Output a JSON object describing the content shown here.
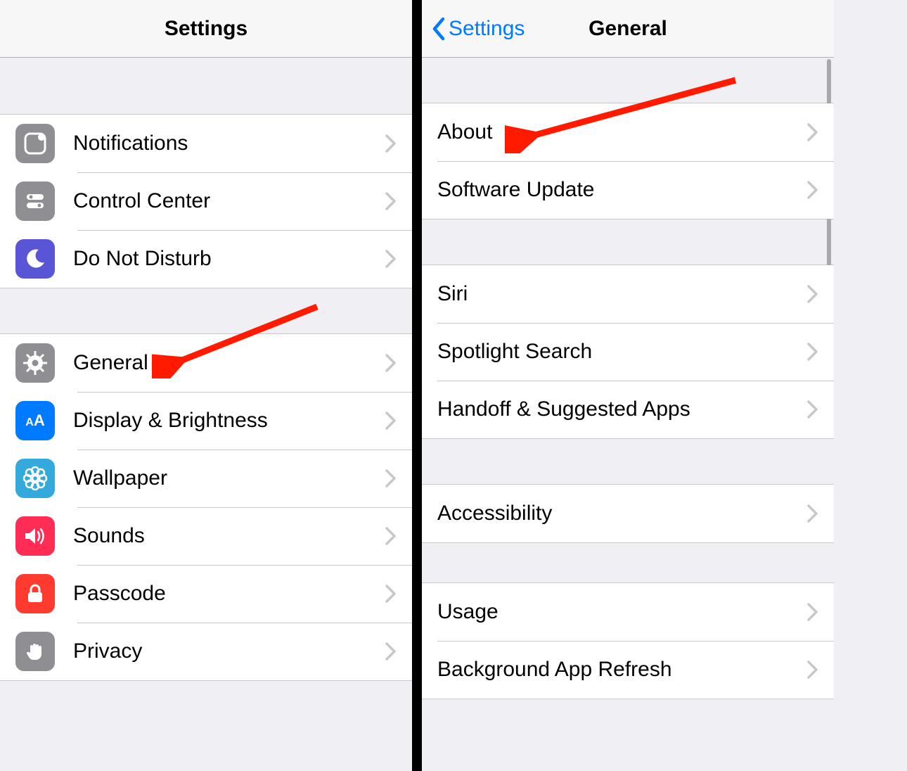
{
  "left": {
    "title": "Settings",
    "groups": [
      {
        "rows": [
          {
            "id": "notifications",
            "label": "Notifications",
            "icon": "notifications-icon",
            "icon_bg": "bg-gray"
          },
          {
            "id": "control-center",
            "label": "Control Center",
            "icon": "control-center-icon",
            "icon_bg": "bg-gray"
          },
          {
            "id": "do-not-disturb",
            "label": "Do Not Disturb",
            "icon": "moon-icon",
            "icon_bg": "bg-purple"
          }
        ]
      },
      {
        "rows": [
          {
            "id": "general",
            "label": "General",
            "icon": "gear-icon",
            "icon_bg": "bg-gray"
          },
          {
            "id": "display-brightness",
            "label": "Display & Brightness",
            "icon": "aa-icon",
            "icon_bg": "bg-blue"
          },
          {
            "id": "wallpaper",
            "label": "Wallpaper",
            "icon": "flower-icon",
            "icon_bg": "bg-cyan"
          },
          {
            "id": "sounds",
            "label": "Sounds",
            "icon": "speaker-icon",
            "icon_bg": "bg-red"
          },
          {
            "id": "passcode",
            "label": "Passcode",
            "icon": "lock-icon",
            "icon_bg": "bg-red2"
          },
          {
            "id": "privacy",
            "label": "Privacy",
            "icon": "hand-icon",
            "icon_bg": "bg-gray"
          }
        ]
      }
    ]
  },
  "right": {
    "back_label": "Settings",
    "title": "General",
    "groups": [
      {
        "rows": [
          {
            "id": "about",
            "label": "About"
          },
          {
            "id": "software-update",
            "label": "Software Update"
          }
        ]
      },
      {
        "rows": [
          {
            "id": "siri",
            "label": "Siri"
          },
          {
            "id": "spotlight-search",
            "label": "Spotlight Search"
          },
          {
            "id": "handoff",
            "label": "Handoff & Suggested Apps"
          }
        ]
      },
      {
        "rows": [
          {
            "id": "accessibility",
            "label": "Accessibility"
          }
        ]
      },
      {
        "rows": [
          {
            "id": "usage",
            "label": "Usage"
          },
          {
            "id": "background-app-refresh",
            "label": "Background App Refresh"
          }
        ]
      }
    ]
  }
}
